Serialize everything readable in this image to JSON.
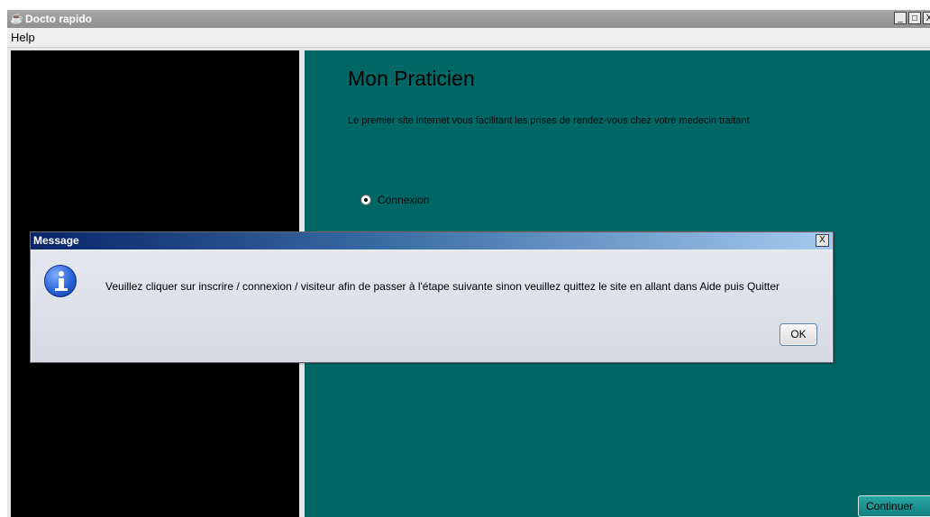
{
  "window": {
    "title": "Docto rapido",
    "controls": {
      "minimize": "_",
      "maximize": "□",
      "close": "X"
    }
  },
  "menu": {
    "items": [
      "Help"
    ]
  },
  "main": {
    "title": "Mon Praticien",
    "subtitle": "Le premier site internet vous facilitant les prises de rendez-vous chez votre medecin traitant",
    "radio": {
      "label": "Connexion",
      "selected": true
    },
    "continue_label": "Continuer"
  },
  "dialog": {
    "title": "Message",
    "close": "X",
    "message": "Veuillez cliquer sur inscrire / connexion / visiteur afin de passer à l'étape suivante sinon veuillez quittez le site en allant dans Aide puis Quitter",
    "ok_label": "OK",
    "icon": "info-icon"
  },
  "colors": {
    "panel_teal": "#006666",
    "panel_black": "#000000",
    "dialog_title_start": "#0a246a",
    "dialog_title_end": "#a6caf0"
  }
}
